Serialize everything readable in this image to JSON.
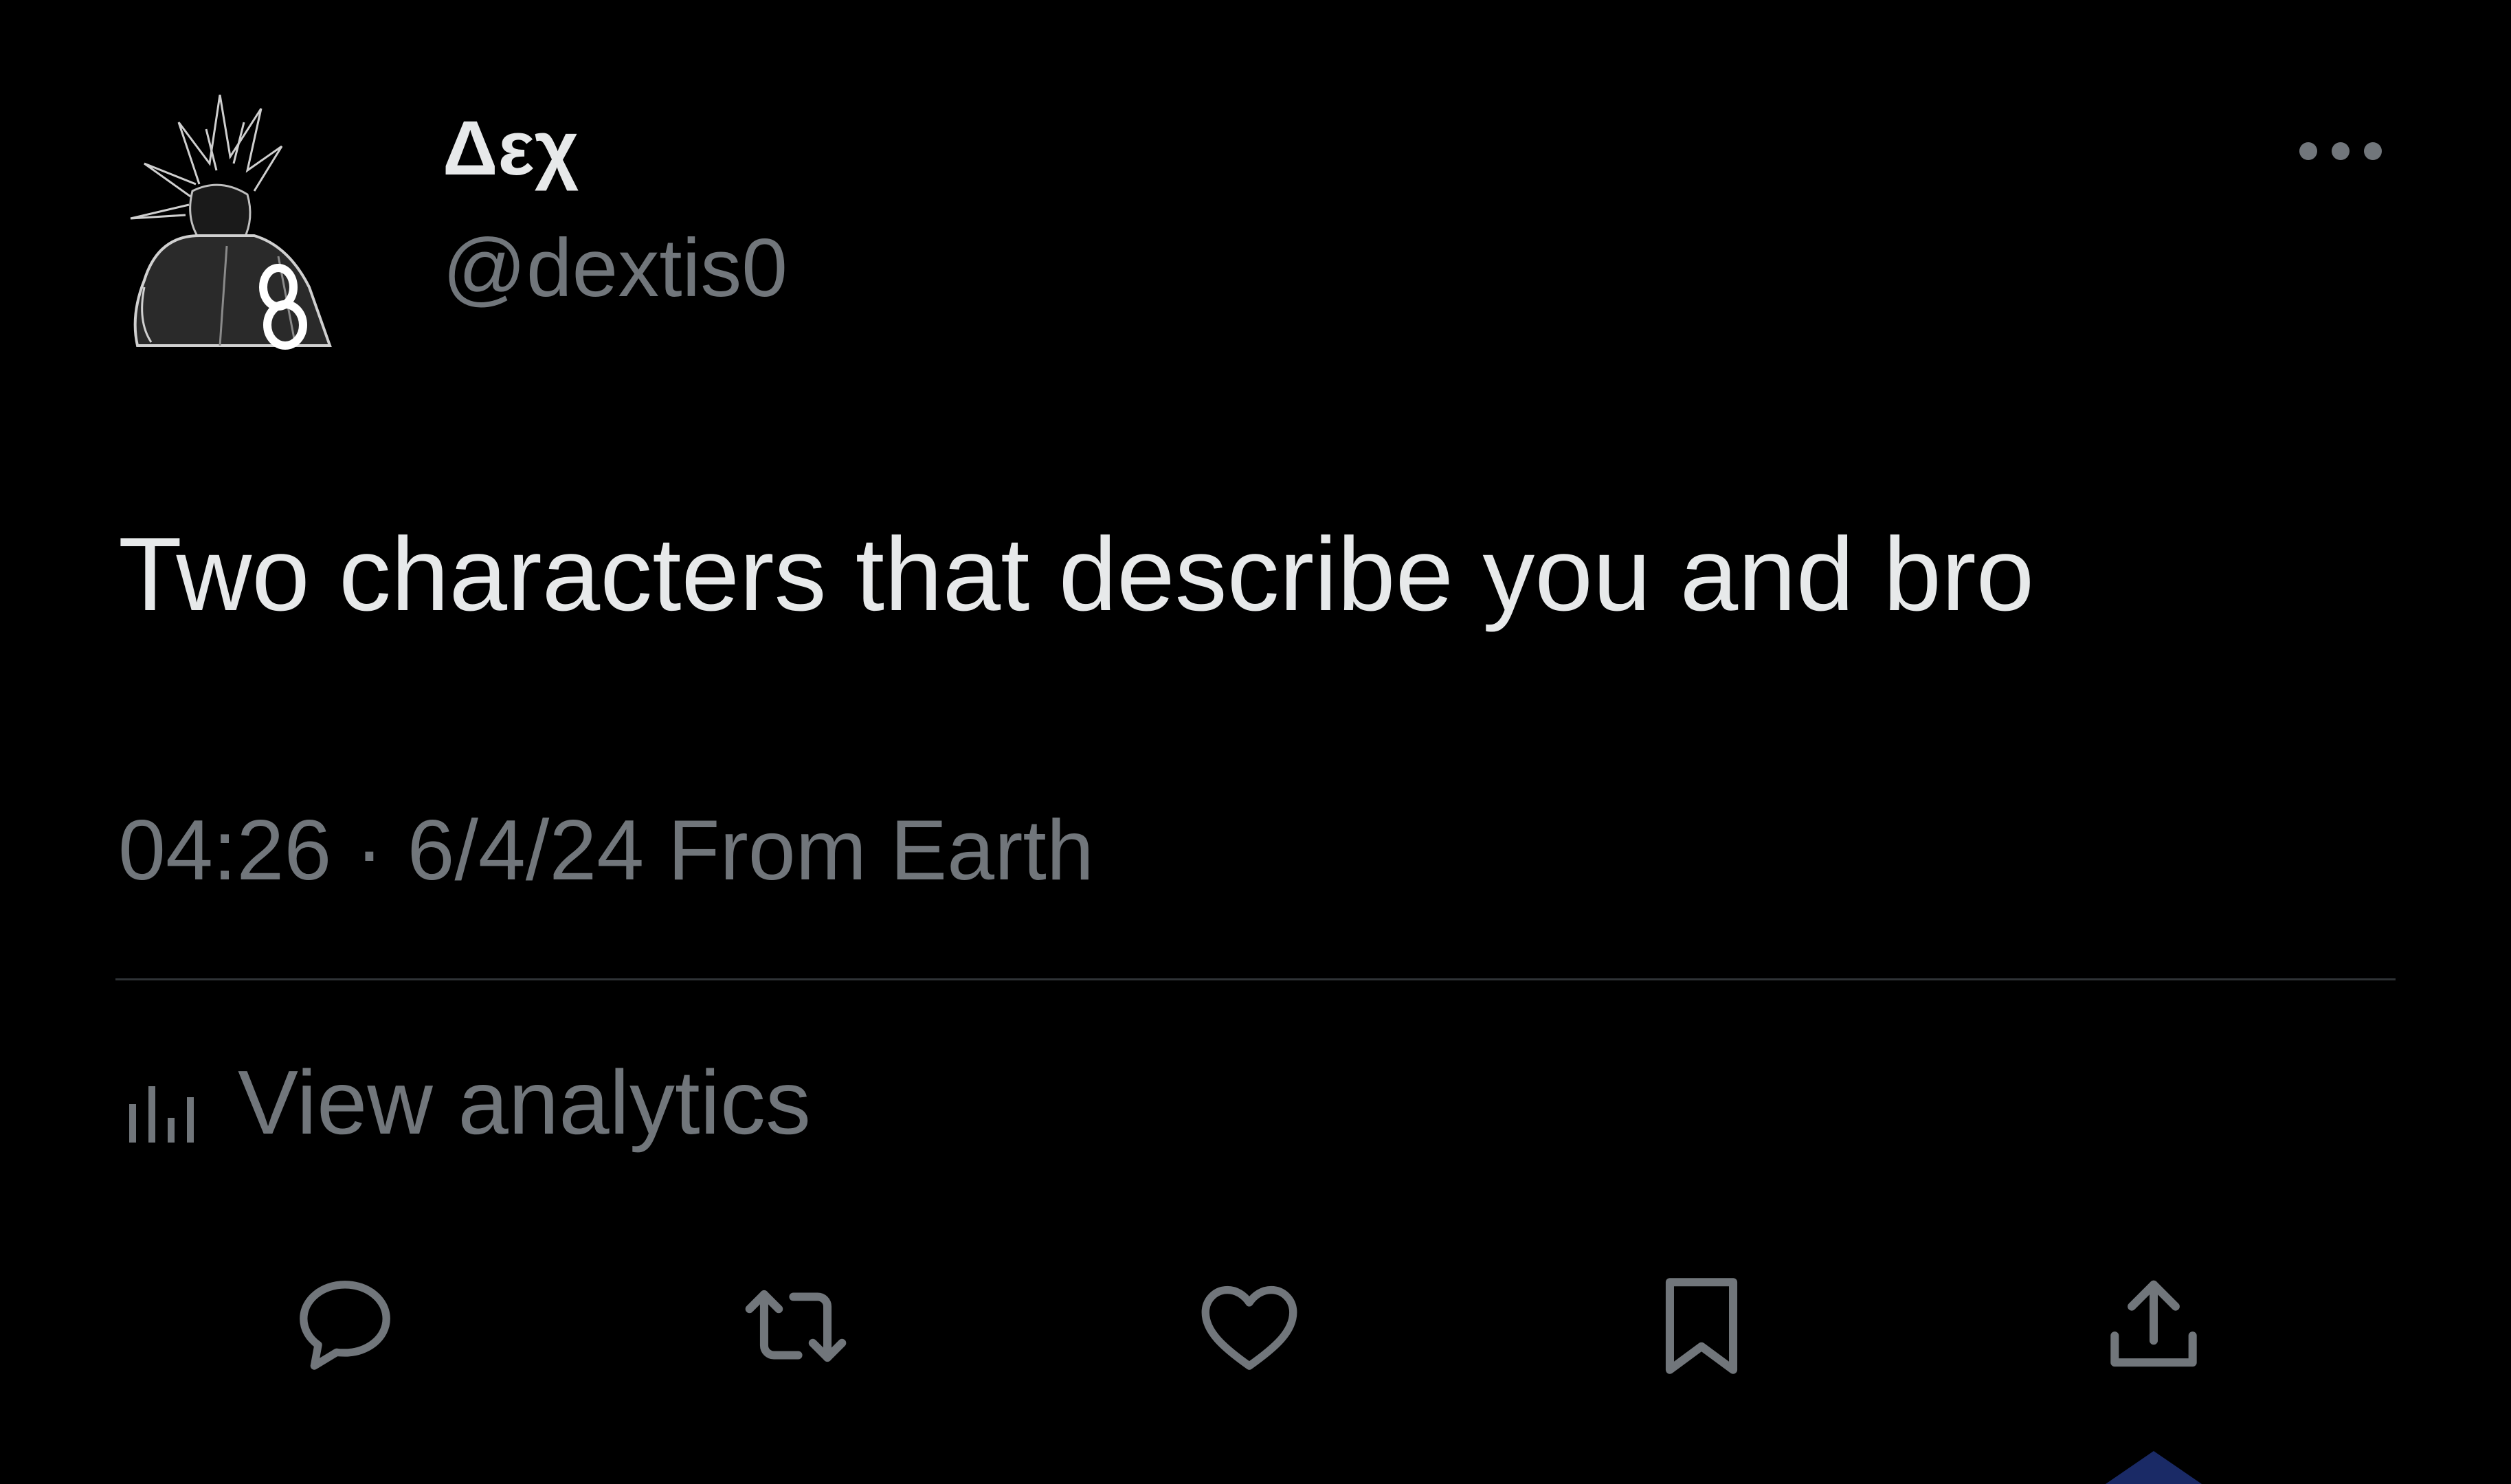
{
  "user": {
    "display_name": "Δεχ",
    "handle": "@dextis0",
    "avatar_icon": "anime-character-avatar"
  },
  "header": {
    "more_icon": "more-horizontal-icon"
  },
  "tweet": {
    "text": "Two characters that describe you and bro",
    "meta": "04:26 · 6/4/24 From Earth"
  },
  "analytics": {
    "icon": "analytics-bar-icon",
    "label": "View analytics"
  },
  "actions": [
    {
      "icon": "reply-icon"
    },
    {
      "icon": "repost-icon"
    },
    {
      "icon": "like-icon"
    },
    {
      "icon": "bookmark-icon"
    },
    {
      "icon": "share-icon"
    }
  ],
  "colors": {
    "background": "#000000",
    "primary_text": "#e7e9ea",
    "secondary_text": "#71767b",
    "divider": "#2f3336",
    "active_indicator": "#1a2a66"
  }
}
